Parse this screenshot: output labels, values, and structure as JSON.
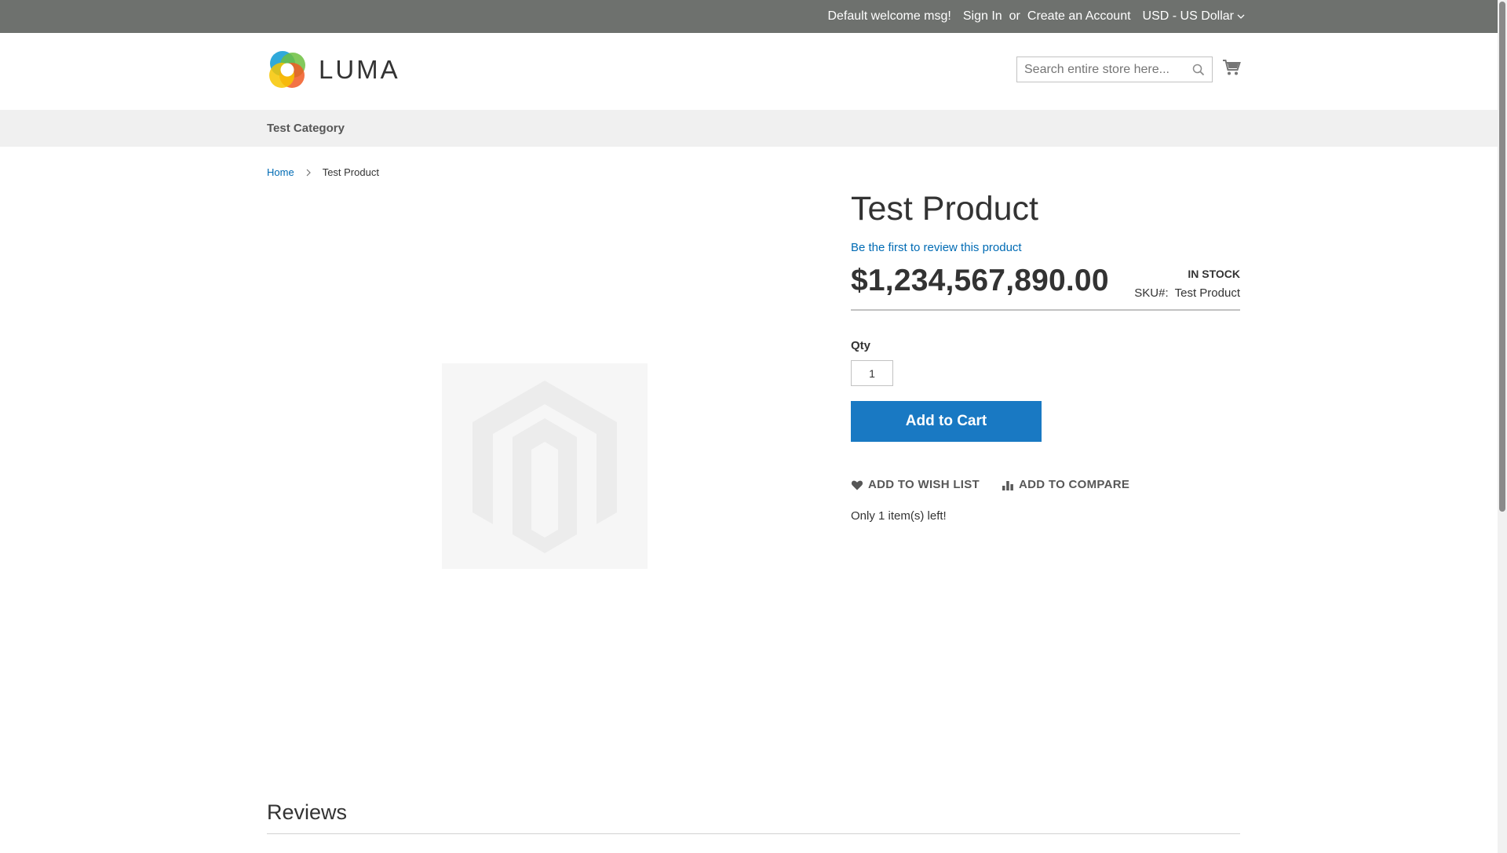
{
  "panel": {
    "welcome": "Default welcome msg!",
    "sign_in": "Sign In",
    "or": "or",
    "create_account": "Create an Account",
    "currency": "USD - US Dollar"
  },
  "header": {
    "logo_text": "LUMA",
    "search_placeholder": "Search entire store here...",
    "cart_icon": "shopping-cart-icon"
  },
  "nav": {
    "items": [
      {
        "label": "Test Category"
      }
    ]
  },
  "breadcrumb": {
    "home": "Home",
    "current": "Test Product"
  },
  "product": {
    "title": "Test Product",
    "review_link": "Be the first to review this product",
    "price": "$1,234,567,890.00",
    "stock_status": "In stock",
    "sku_label": "SKU#:",
    "sku_value": "Test Product",
    "qty_label": "Qty",
    "qty_value": "1",
    "add_to_cart": "Add to Cart",
    "add_to_wishlist": "Add to Wish List",
    "add_to_compare": "Add to Compare",
    "stock_left": "Only 1 item(s) left!"
  },
  "reviews": {
    "title": "Reviews"
  },
  "colors": {
    "panel_bg": "#6e716e",
    "accent": "#1979c3",
    "link": "#006bb4",
    "nav_bg": "#f0f0f0"
  }
}
